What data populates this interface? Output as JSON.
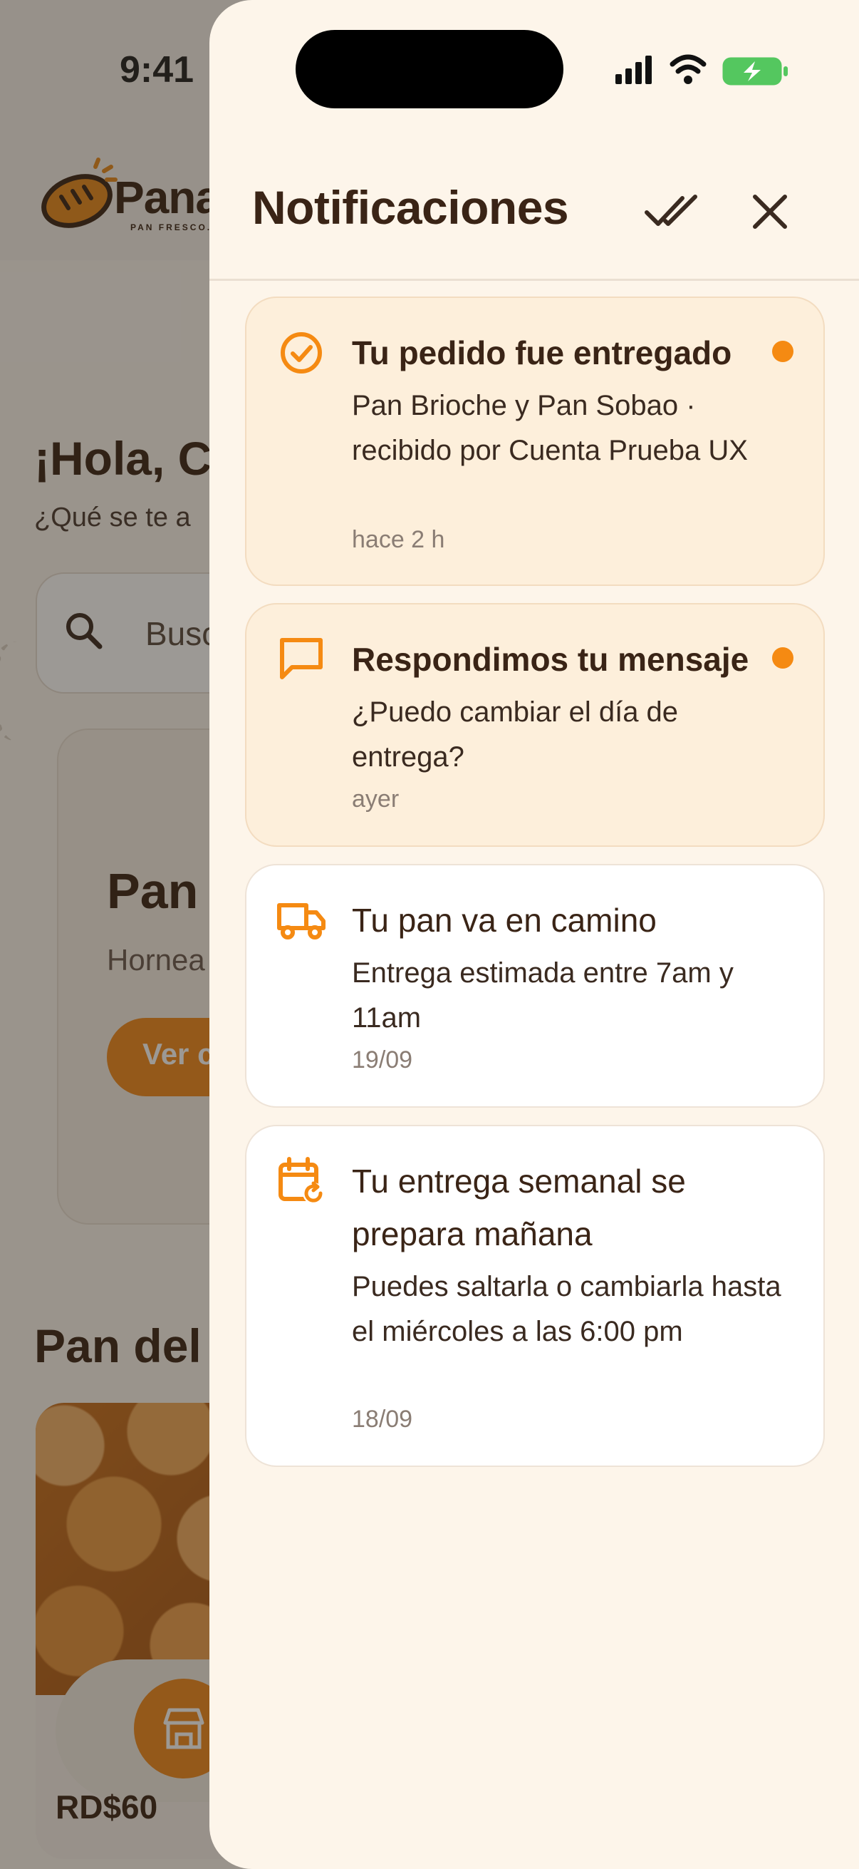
{
  "status_bar": {
    "time": "9:41"
  },
  "background": {
    "brand": "Pana",
    "brand_tagline": "PAN FRESCO.",
    "greeting": "¡Hola, C",
    "question": "¿Qué se te a",
    "search_placeholder": "Busc",
    "hero_title": "Pan",
    "hero_subtitle": "Hornea",
    "hero_button": "Ver c",
    "section_title": "Pan del",
    "card_price": "RD$60"
  },
  "drawer": {
    "title": "Notificaciones",
    "mark_all_icon": "double-check-icon",
    "close_icon": "close-icon",
    "notifications": [
      {
        "icon": "check-circle-icon",
        "title": "Tu pedido fue entregado",
        "body": "Pan Brioche y Pan Sobao · recibido por Cuenta Prueba UX",
        "time": "hace 2 h",
        "unread": true
      },
      {
        "icon": "message-icon",
        "title": "Respondimos tu mensaje",
        "body": "¿Puedo cambiar el día de entrega?",
        "time": "ayer",
        "unread": true
      },
      {
        "icon": "truck-icon",
        "title": "Tu pan va en camino",
        "body": "Entrega estimada entre 7am y 11am",
        "time": "19/09",
        "unread": false
      },
      {
        "icon": "calendar-repeat-icon",
        "title": "Tu entrega semanal se prepara mañana",
        "body": "Puedes saltarla o cambiarla hasta el miércoles a las 6:00 pm",
        "time": "18/09",
        "unread": false
      }
    ]
  },
  "colors": {
    "accent": "#f58a12",
    "text_brown": "#3a2416",
    "drawer_bg": "#fdf5ea",
    "unread_bg": "#fdefdb"
  }
}
